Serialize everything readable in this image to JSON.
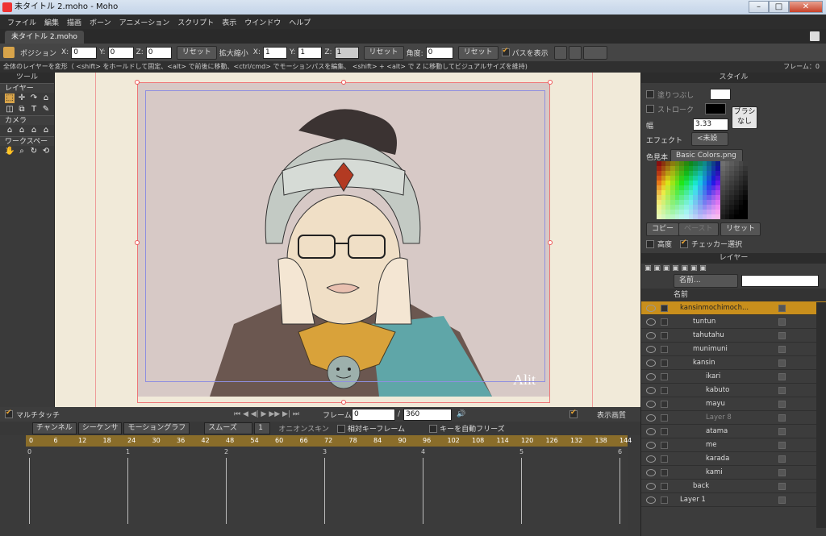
{
  "window": {
    "title": "未タイトル 2.moho - Moho",
    "min": "–",
    "max": "□",
    "close": "✕"
  },
  "menu": [
    "ファイル",
    "編集",
    "描画",
    "ボーン",
    "アニメーション",
    "スクリプト",
    "表示",
    "ウインドウ",
    "ヘルプ"
  ],
  "doc_tab": "未タイトル 2.moho",
  "toolopts": {
    "position_label": "ポジション",
    "x_label": "X:",
    "y_label": "Y:",
    "z_label": "Z:",
    "pos_x": "0",
    "pos_y": "0",
    "pos_z": "0",
    "reset": "リセット",
    "scale_label": "拡大縮小",
    "sx": "1",
    "sy": "1",
    "sz": "1",
    "angle_label": "角度:",
    "angle": "0",
    "path_label": "パスを表示"
  },
  "status": {
    "text": "全体のレイヤーを変形（ <shift> をホールドして固定、<alt> で前後に移動、<ctrl/cmd> でモーションパスを編集、 <shift> + <alt> で Z に移動してビジュアルサイズを維持)",
    "frame": "フレーム：0"
  },
  "tools": {
    "title": "ツール",
    "layer": "レイヤー",
    "camera": "カメラ",
    "workspace": "ワークスペース"
  },
  "timeline": {
    "multitouch": "マルチタッチ",
    "frame_label": "フレーム",
    "frame": "0",
    "total": "360",
    "display_quality": "表示画質",
    "tabs": [
      "チャンネル",
      "シーケンサ",
      "モーショングラフ"
    ],
    "smooth": "スムーズ",
    "interp": "1",
    "onion": "オニオンスキン",
    "relative_key": "相対キーフレーム",
    "auto_freeze": "キーを自動フリーズ",
    "ruler": [
      "0",
      "6",
      "12",
      "18",
      "24",
      "30",
      "36",
      "42",
      "48",
      "54",
      "60",
      "66",
      "72",
      "78",
      "84",
      "90",
      "96",
      "102",
      "108",
      "114",
      "120",
      "126",
      "132",
      "138",
      "144"
    ],
    "seconds": [
      "0",
      "1",
      "2",
      "3",
      "4",
      "5",
      "6"
    ]
  },
  "style": {
    "title": "スタイル",
    "fill": "塗りつぶし",
    "stroke": "ストローク",
    "width_label": "幅",
    "width": "3.33",
    "brush": "ブラシ\nなし",
    "effect_label": "エフェクト",
    "effect": "<未設",
    "palette_label": "色見本",
    "palette": "Basic Colors.png",
    "copy": "コピー",
    "paste": "ペースト",
    "reset": "リセット",
    "advanced": "高度",
    "checker": "チェッカー選択"
  },
  "layers": {
    "title": "レイヤー",
    "filter": "名前...",
    "name_col": "名前",
    "items": [
      {
        "name": "kansinmochimoch...",
        "indent": 0,
        "sel": true
      },
      {
        "name": "tuntun",
        "indent": 1
      },
      {
        "name": "tahutahu",
        "indent": 1
      },
      {
        "name": "munimuni",
        "indent": 1
      },
      {
        "name": "kansin",
        "indent": 1
      },
      {
        "name": "ikari",
        "indent": 2
      },
      {
        "name": "kabuto",
        "indent": 2
      },
      {
        "name": "mayu",
        "indent": 2
      },
      {
        "name": "Layer 8",
        "indent": 2,
        "dim": true
      },
      {
        "name": "atama",
        "indent": 2
      },
      {
        "name": "me",
        "indent": 2
      },
      {
        "name": "karada",
        "indent": 2
      },
      {
        "name": "kami",
        "indent": 2
      },
      {
        "name": "back",
        "indent": 1
      },
      {
        "name": "Layer 1",
        "indent": 0
      }
    ]
  },
  "canvas": {
    "signature": "Alit"
  }
}
